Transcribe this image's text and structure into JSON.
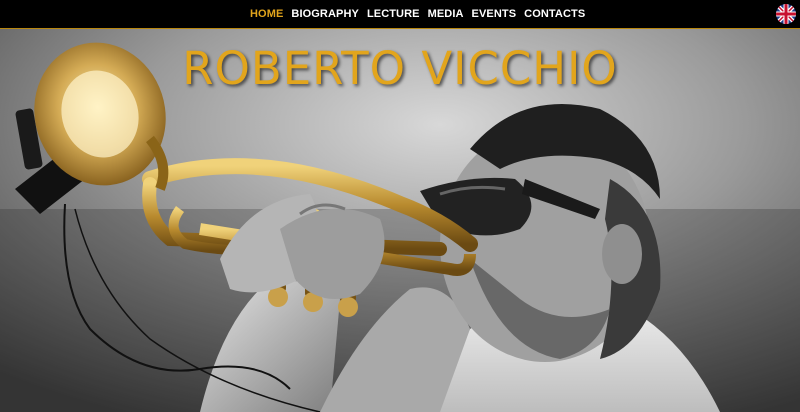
{
  "nav": {
    "items": [
      {
        "label": "HOME",
        "active": true
      },
      {
        "label": "BIOGRAPHY",
        "active": false
      },
      {
        "label": "LECTURE",
        "active": false
      },
      {
        "label": "MEDIA",
        "active": false
      },
      {
        "label": "EVENTS",
        "active": false
      },
      {
        "label": "CONTACTS",
        "active": false
      }
    ],
    "language_icon": "uk-flag-icon"
  },
  "hero": {
    "title": "ROBERTO VICCHIO",
    "image": "trumpet-player-photo"
  },
  "colors": {
    "accent": "#e2a51c",
    "nav_background": "#000000",
    "nav_text": "#ffffff"
  }
}
